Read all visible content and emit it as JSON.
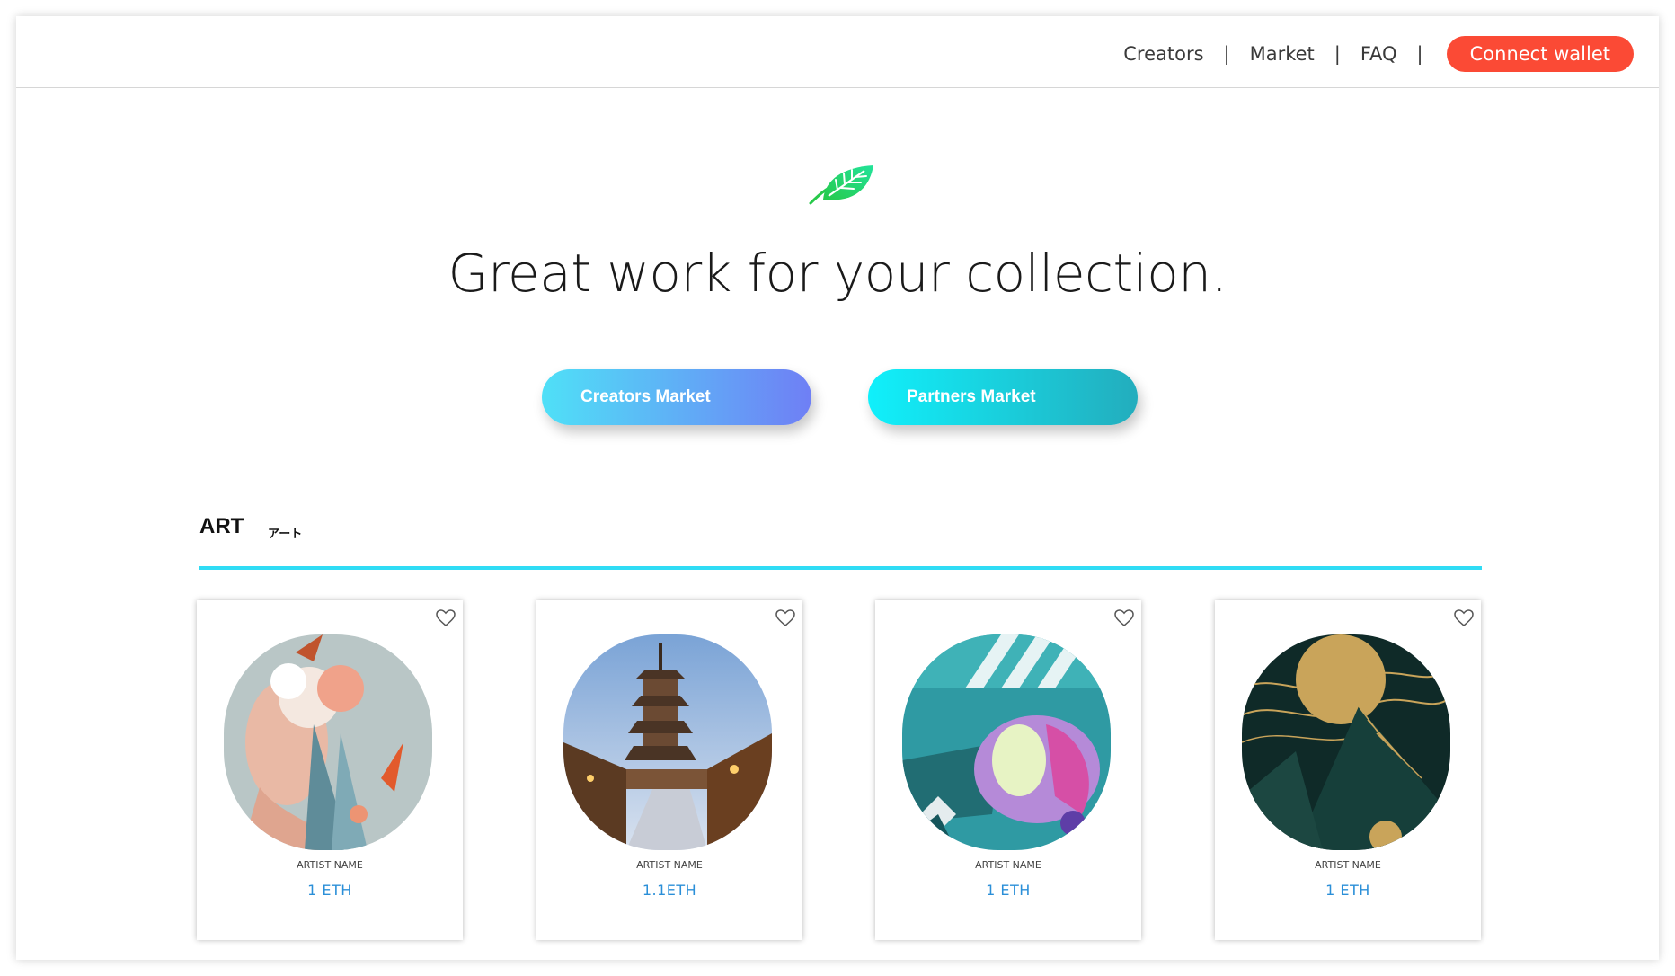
{
  "nav": {
    "items": [
      "Creators",
      "Market",
      "FAQ"
    ],
    "separator": "|",
    "connect_label": "Connect wallet"
  },
  "hero": {
    "logo_icon": "leaf-icon",
    "headline": "Great work for your collection.",
    "creators_button": "Creators Market",
    "partners_button": "Partners Market"
  },
  "section": {
    "title": "ART",
    "subtitle": "アート"
  },
  "cards": [
    {
      "artist": "ARTIST NAME",
      "price": "1 ETH",
      "favorite_icon": "heart-icon"
    },
    {
      "artist": "ARTIST NAME",
      "price": "1.1ETH",
      "favorite_icon": "heart-icon"
    },
    {
      "artist": "ARTIST NAME",
      "price": "1 ETH",
      "favorite_icon": "heart-icon"
    },
    {
      "artist": "ARTIST NAME",
      "price": "1 ETH",
      "favorite_icon": "heart-icon"
    }
  ],
  "colors": {
    "connect": "#fb4a35",
    "accent_rule": "#2fdcf5",
    "price": "#2b8fd8",
    "leaf": "#1fcf5a"
  }
}
